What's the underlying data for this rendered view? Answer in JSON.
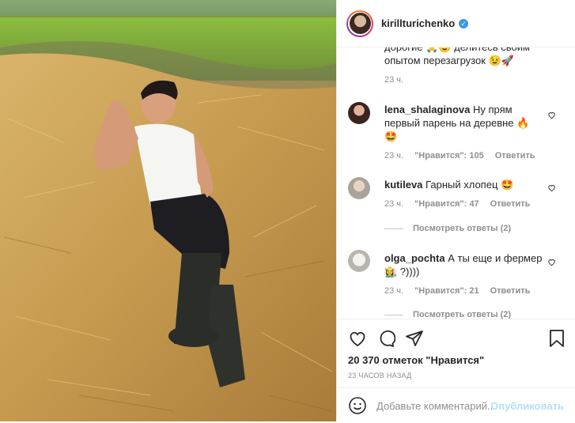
{
  "header": {
    "username": "kirillturichenko"
  },
  "comments": [
    {
      "text_line1": "дорогие 🙏😉 делитесь своим",
      "text_line2": "опытом перезагрузок 😉🚀",
      "time": "23 ч."
    },
    {
      "user": "lena_shalaginova",
      "text_line1": "Ну прям",
      "text_line2": "первый парень на деревне 🔥",
      "text_line3": "🤩",
      "time": "23 ч.",
      "likes": "\"Нравится\": 105",
      "reply": "Ответить"
    },
    {
      "user": "kutileva",
      "text_line1": "Гарный хлопец 🤩",
      "time": "23 ч.",
      "likes": "\"Нравится\": 47",
      "reply": "Ответить",
      "view_replies": "Посмотреть ответы (2)"
    },
    {
      "user": "olga_pochta",
      "text_line1": "А ты еще и фермер",
      "text_line2": "👩‍🌾 ?))))",
      "time": "23 ч.",
      "likes": "\"Нравится\": 21",
      "reply": "Ответить",
      "view_replies": "Посмотреть ответы (2)"
    }
  ],
  "actions": {
    "likes_text": "20 370 отметок \"Нравится\"",
    "time_ago": "23 ЧАСОВ НАЗАД",
    "comment_placeholder": "Добавьте комментарий...",
    "publish_label": "Опубликовать"
  },
  "icons": [
    "heart-icon",
    "comment-icon",
    "share-icon",
    "bookmark-icon",
    "emoji-icon",
    "verified-icon"
  ]
}
